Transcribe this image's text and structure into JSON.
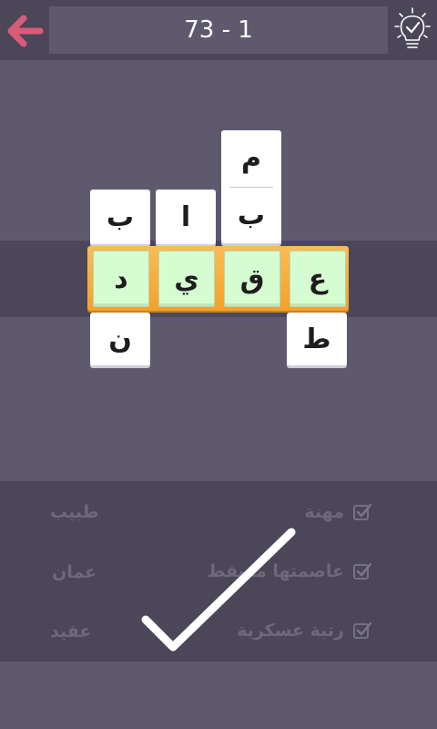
{
  "header": {
    "level_label": "73 - 1"
  },
  "icons": {
    "back": "arrow-left-icon",
    "hint": "lightbulb-check-icon",
    "clue_check": "checkbox-checked-icon",
    "completed": "checkmark-icon"
  },
  "colors": {
    "accent": "#d95b7a",
    "highlight_row": "#f3a12b",
    "solved_tile": "#d6fdd2"
  },
  "grid": {
    "answer_letters": [
      "د",
      "ي",
      "ق",
      "ع"
    ],
    "col1_above": "ب",
    "col1_below": "ن",
    "col2_above": "ا",
    "col3_above_top": "م",
    "col3_above_bottom": "ب",
    "col4_below": "ط"
  },
  "clues": [
    {
      "text": "مهنة",
      "answer": "طبيب",
      "solved": true
    },
    {
      "text": "عاصمتها مسقط",
      "answer": "عمان",
      "solved": true
    },
    {
      "text": "رتبة عسكرية",
      "answer": "عقيد",
      "solved": true
    }
  ]
}
